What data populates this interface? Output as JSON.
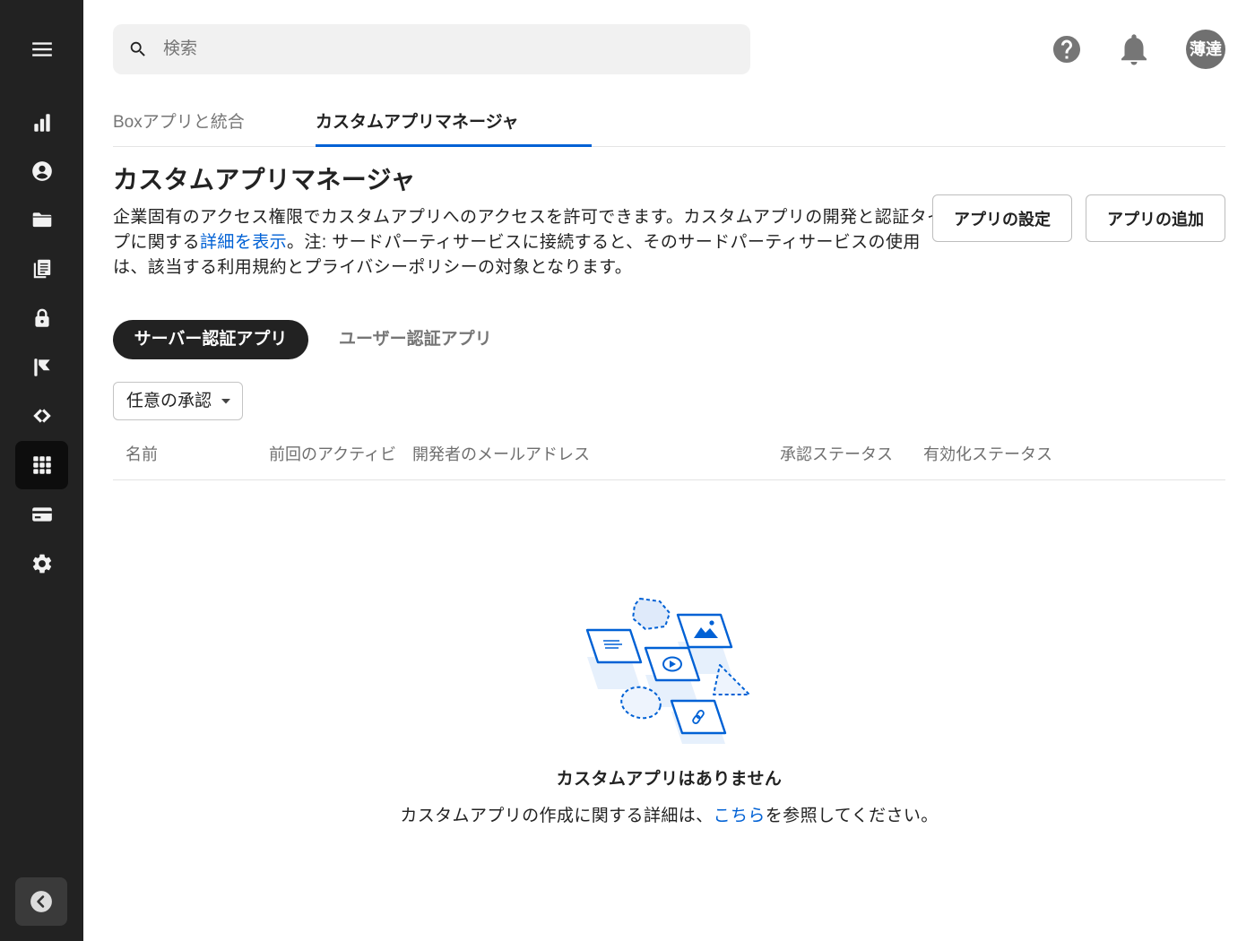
{
  "sidebar": {
    "items": [
      {
        "icon": "menu-icon"
      },
      {
        "icon": "bar-chart-icon"
      },
      {
        "icon": "account-circle-icon"
      },
      {
        "icon": "folder-icon"
      },
      {
        "icon": "file-copy-icon"
      },
      {
        "icon": "lock-icon"
      },
      {
        "icon": "flag-icon"
      },
      {
        "icon": "relay-icon"
      },
      {
        "icon": "apps-grid-icon",
        "active": true
      },
      {
        "icon": "credit-card-icon"
      },
      {
        "icon": "gear-icon"
      }
    ],
    "collapse_icon": "chevron-left-circle-icon"
  },
  "header": {
    "search": {
      "placeholder": "検索",
      "value": "",
      "icon": "search-icon"
    },
    "help_icon": "help-icon",
    "notifications_icon": "bell-icon",
    "avatar": {
      "initials": "薄達"
    }
  },
  "tabs": [
    {
      "label": "Boxアプリと統合",
      "active": false
    },
    {
      "label": "カスタムアプリマネージャ",
      "active": true
    }
  ],
  "page": {
    "title": "カスタムアプリマネージャ",
    "description": {
      "before_link": "企業固有のアクセス権限でカスタムアプリへのアクセスを許可できます。カスタムアプリの開発と認証タイプに関する",
      "link": "詳細を表示",
      "after_link": "。注: サードパーティサービスに接続すると、そのサードパーティサービスの使用は、該当する利用規約とプライバシーポリシーの対象となります。"
    },
    "actions": {
      "settings": "アプリの設定",
      "add": "アプリの追加"
    }
  },
  "auth_tabs": [
    {
      "label": "サーバー認証アプリ",
      "active": true
    },
    {
      "label": "ユーザー認証アプリ",
      "active": false
    }
  ],
  "filter": {
    "selected": "任意の承認",
    "icon": "caret-down-icon"
  },
  "table": {
    "columns": [
      "名前",
      "前回のアクティビ",
      "開発者のメールアドレス",
      "承認ステータス",
      "有効化ステータス"
    ],
    "rows": []
  },
  "empty_state": {
    "title": "カスタムアプリはありません",
    "text_before": "カスタムアプリの作成に関する詳細は、",
    "link": "こちら",
    "text_after": "を参照してください。"
  },
  "colors": {
    "sidebar_bg": "#222222",
    "accent": "#0061d5",
    "text": "#222222",
    "muted": "#767676",
    "search_bg": "#f1f1f1"
  }
}
